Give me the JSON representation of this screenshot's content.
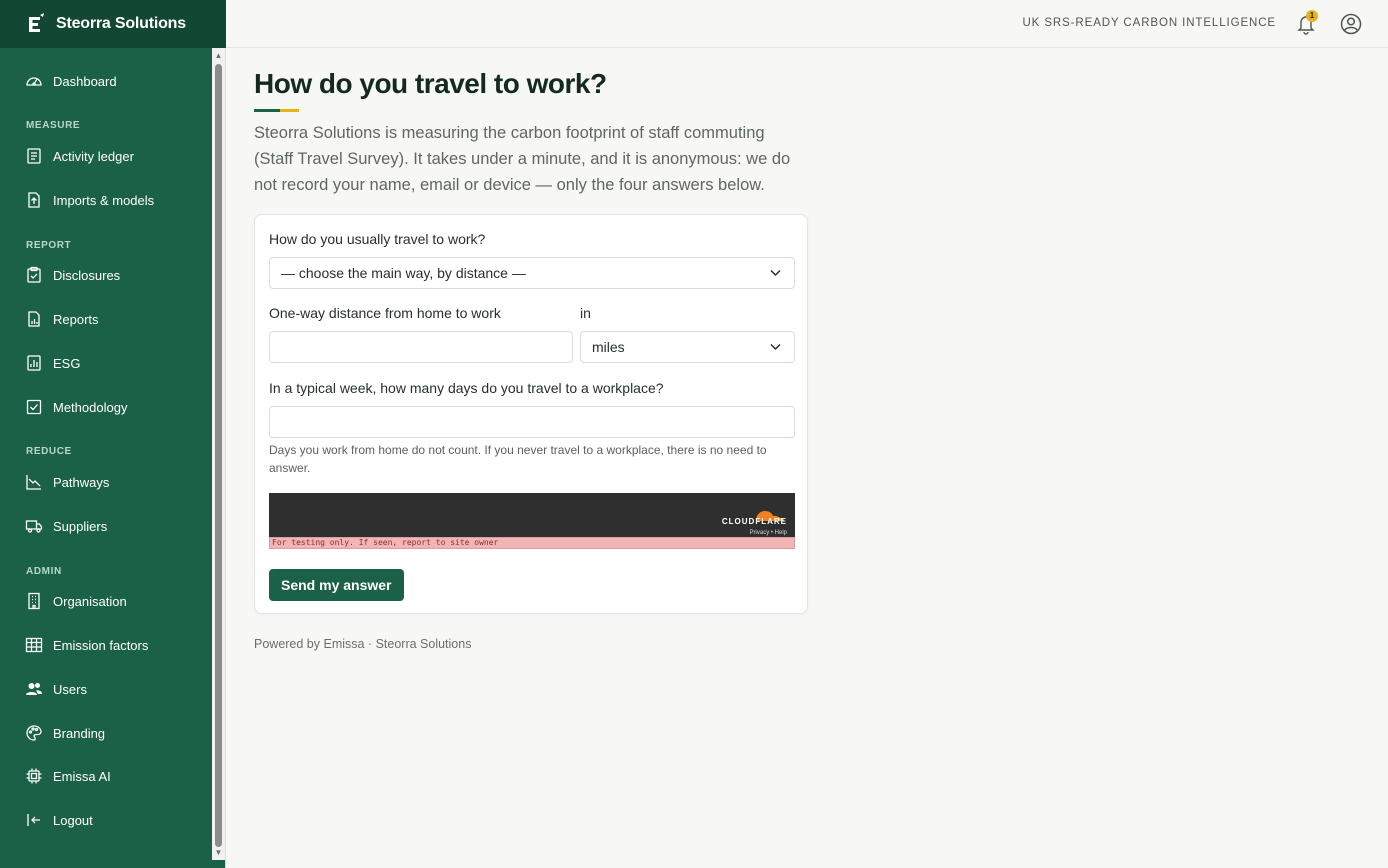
{
  "brand": {
    "name": "Steorra Solutions"
  },
  "sidebar": {
    "sections": [
      "MEASURE",
      "REPORT",
      "REDUCE",
      "ADMIN"
    ],
    "items": [
      {
        "label": "Dashboard",
        "icon": "gauge-icon"
      },
      {
        "label": "Activity ledger",
        "icon": "ledger-icon"
      },
      {
        "label": "Imports & models",
        "icon": "upload-file-icon"
      },
      {
        "label": "Disclosures",
        "icon": "clipboard-check-icon"
      },
      {
        "label": "Reports",
        "icon": "report-chart-icon"
      },
      {
        "label": "ESG",
        "icon": "esg-chart-icon"
      },
      {
        "label": "Methodology",
        "icon": "checklist-icon"
      },
      {
        "label": "Pathways",
        "icon": "trend-down-icon"
      },
      {
        "label": "Suppliers",
        "icon": "truck-icon"
      },
      {
        "label": "Organisation",
        "icon": "building-icon"
      },
      {
        "label": "Emission factors",
        "icon": "table-icon"
      },
      {
        "label": "Users",
        "icon": "users-icon"
      },
      {
        "label": "Branding",
        "icon": "palette-icon"
      },
      {
        "label": "Emissa AI",
        "icon": "chip-icon"
      },
      {
        "label": "Logout",
        "icon": "logout-icon"
      }
    ]
  },
  "topbar": {
    "tagline": "UK SRS-READY CARBON INTELLIGENCE",
    "notification_count": "1"
  },
  "page": {
    "title": "How do you travel to work?",
    "intro": "Steorra Solutions is measuring the carbon footprint of staff commuting (Staff Travel Survey). It takes under a minute, and it is anonymous: we do not record your name, email or device — only the four answers below."
  },
  "form": {
    "mode_label": "How do you usually travel to work?",
    "mode_value": "— choose the main way, by distance —",
    "distance_label": "One-way distance from home to work",
    "distance_value": "",
    "unit_label": "in",
    "unit_value": "miles",
    "days_label": "In a typical week, how many days do you travel to a workplace?",
    "days_value": "",
    "days_help": "Days you work from home do not count. If you never travel to a workplace, there is no need to answer.",
    "submit_label": "Send my answer"
  },
  "captcha": {
    "brand": "CLOUDFLARE",
    "links": "Privacy • Help",
    "warning": "For testing only. If seen, report to site owner"
  },
  "footer": {
    "text": "Powered by Emissa · Steorra Solutions"
  },
  "colors": {
    "sidebar": "#1b6147",
    "brand_bar": "#124733",
    "accent_yellow": "#e8b31a",
    "background": "#f7f7f5"
  }
}
